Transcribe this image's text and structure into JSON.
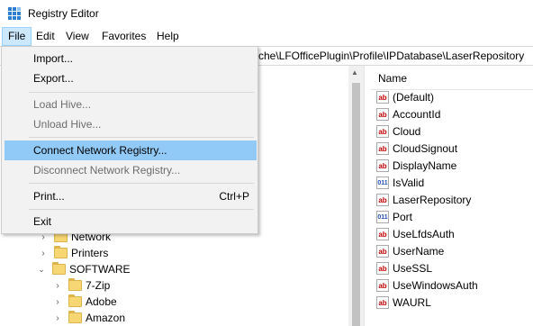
{
  "window": {
    "title": "Registry Editor"
  },
  "menubar": {
    "items": [
      "File",
      "Edit",
      "View",
      "Favorites",
      "Help"
    ]
  },
  "address": {
    "path": "che\\LFOfficePlugin\\Profile\\IPDatabase\\LaserRepository"
  },
  "file_menu": {
    "import": "Import...",
    "export": "Export...",
    "load_hive": "Load Hive...",
    "unload_hive": "Unload Hive...",
    "connect": "Connect Network Registry...",
    "disconnect": "Disconnect Network Registry...",
    "print": "Print...",
    "print_shortcut": "Ctrl+P",
    "exit": "Exit"
  },
  "tree": {
    "network": "Network",
    "printers": "Printers",
    "software": "SOFTWARE",
    "zip": "7-Zip",
    "adobe": "Adobe",
    "amazon": "Amazon"
  },
  "values": {
    "header": "Name",
    "items": [
      {
        "name": "(Default)",
        "type": "ab"
      },
      {
        "name": "AccountId",
        "type": "ab"
      },
      {
        "name": "Cloud",
        "type": "ab"
      },
      {
        "name": "CloudSignout",
        "type": "ab"
      },
      {
        "name": "DisplayName",
        "type": "ab"
      },
      {
        "name": "IsValid",
        "type": "dword"
      },
      {
        "name": "LaserRepository",
        "type": "ab"
      },
      {
        "name": "Port",
        "type": "dword"
      },
      {
        "name": "UseLfdsAuth",
        "type": "ab"
      },
      {
        "name": "UserName",
        "type": "ab"
      },
      {
        "name": "UseSSL",
        "type": "ab"
      },
      {
        "name": "UseWindowsAuth",
        "type": "ab"
      },
      {
        "name": "WAURL",
        "type": "ab"
      }
    ]
  },
  "icons": {
    "string_value": "ab",
    "dword_value": "011"
  },
  "colors": {
    "highlight": "#91c9f7",
    "menu_bg": "#f2f2f2",
    "menu_active": "#cce8ff"
  }
}
